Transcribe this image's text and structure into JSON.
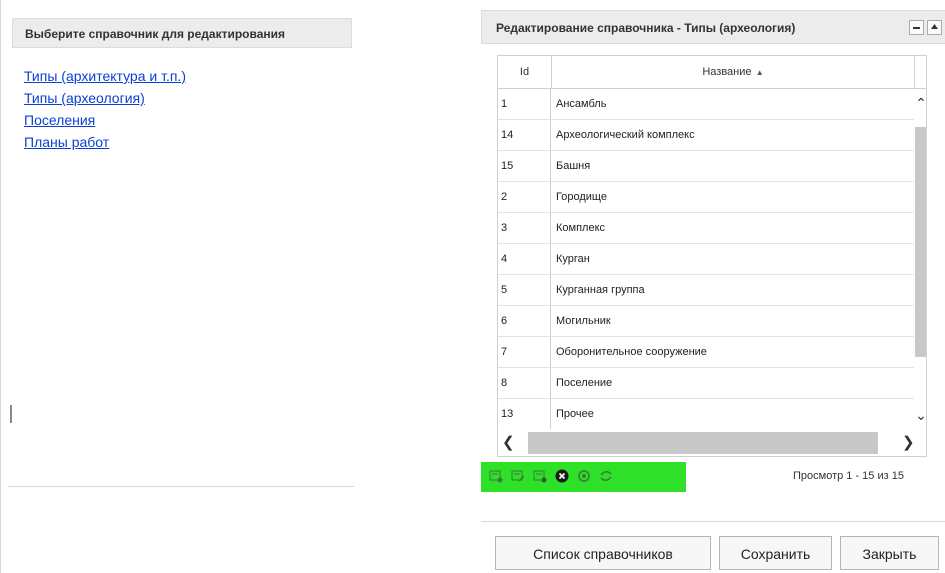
{
  "left": {
    "header": "Выберите справочник для редактирования",
    "dictionaries": [
      "Типы (архитектура и т.п.)",
      "Типы (археология)",
      "Поселения",
      "Планы работ"
    ]
  },
  "editor": {
    "title": "Редактирование справочника - Типы (археология)",
    "columns": {
      "id": "Id",
      "name": "Название"
    },
    "rows": [
      {
        "id": "1",
        "name": "Ансамбль"
      },
      {
        "id": "14",
        "name": "Археологический комплекс"
      },
      {
        "id": "15",
        "name": "Башня"
      },
      {
        "id": "2",
        "name": "Городище"
      },
      {
        "id": "3",
        "name": "Комплекс"
      },
      {
        "id": "4",
        "name": "Курган"
      },
      {
        "id": "5",
        "name": "Курганная группа"
      },
      {
        "id": "6",
        "name": "Могильник"
      },
      {
        "id": "7",
        "name": "Оборонительное сооружение"
      },
      {
        "id": "8",
        "name": "Поселение"
      },
      {
        "id": "13",
        "name": "Прочее"
      }
    ],
    "pager_info": "Просмотр 1 - 15 из 15",
    "buttons": {
      "list": "Список справочников",
      "save": "Сохранить",
      "close": "Закрыть"
    },
    "toolbar_highlight_color": "#2fe028"
  }
}
